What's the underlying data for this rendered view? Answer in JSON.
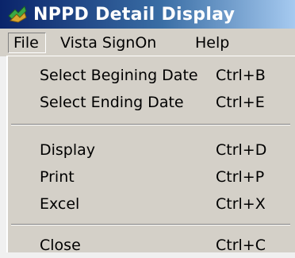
{
  "window": {
    "title": "NPPD Detail Display",
    "icon": "app-icon"
  },
  "menubar": {
    "items": [
      {
        "label": "File",
        "state": "open"
      },
      {
        "label": "Vista SignOn"
      },
      {
        "label": "Help"
      }
    ]
  },
  "file_menu": {
    "items": [
      {
        "label": "Select Begining Date",
        "shortcut": "Ctrl+B"
      },
      {
        "label": "Select Ending Date",
        "shortcut": "Ctrl+E"
      },
      {
        "label": "Display",
        "shortcut": "Ctrl+D"
      },
      {
        "label": "Print",
        "shortcut": "Ctrl+P"
      },
      {
        "label": "Excel",
        "shortcut": "Ctrl+X"
      },
      {
        "label": "Close",
        "shortcut": "Ctrl+C"
      }
    ]
  },
  "colors": {
    "titlebar_start": "#0a246a",
    "titlebar_end": "#a6caf0",
    "menu_bg": "#d4d0c8"
  }
}
